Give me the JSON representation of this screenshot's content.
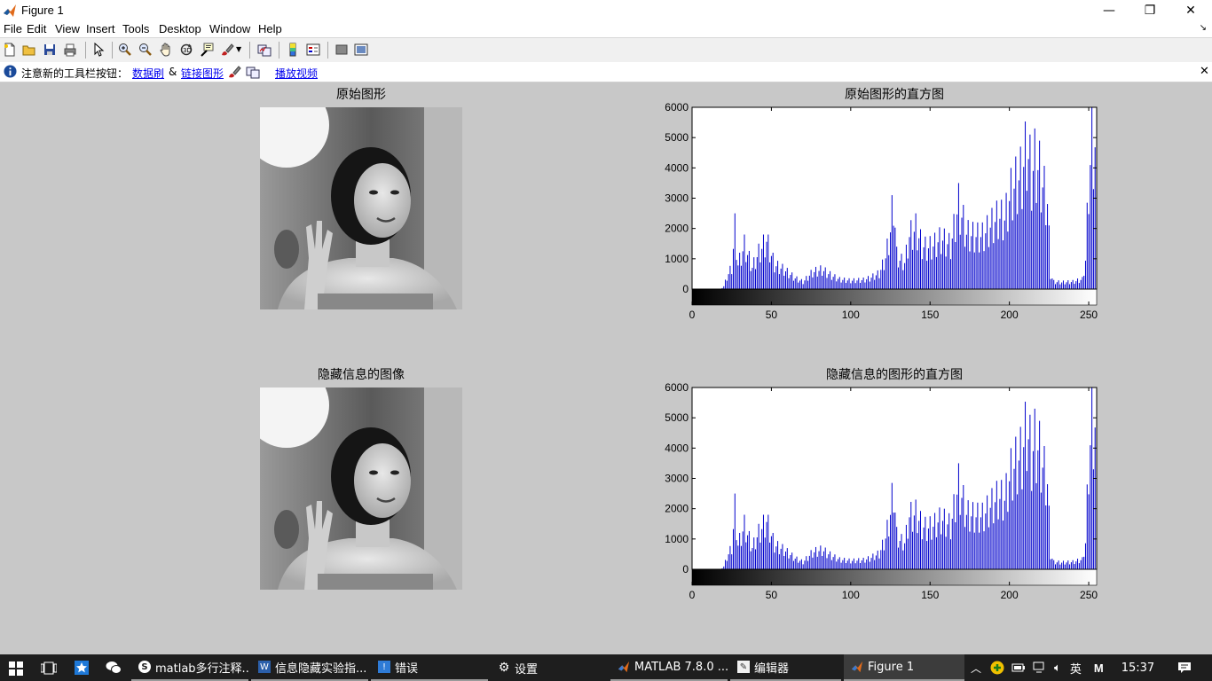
{
  "window": {
    "title": "Figure 1",
    "minimize": "—",
    "restore": "❐",
    "close": "✕"
  },
  "menu": [
    "File",
    "Edit",
    "View",
    "Insert",
    "Tools",
    "Desktop",
    "Window",
    "Help"
  ],
  "infobar": {
    "text": "注意新的工具栏按钮：",
    "link_brush": "数据刷",
    "amp": "&",
    "link_link": "链接图形",
    "link_play": "播放视频",
    "close": "✕"
  },
  "plots": {
    "top_left_title": "原始图形",
    "top_right_title": "原始图形的直方图",
    "bottom_left_title": "隐藏信息的图像",
    "bottom_right_title": "隐藏信息的图形的直方图"
  },
  "colors": {
    "bar": "#0000cc",
    "figure_bg": "#c8c8c8"
  },
  "chart_data": [
    {
      "type": "bar",
      "title": "原始图形的直方图",
      "xlim": [
        0,
        255
      ],
      "ylim": [
        0,
        6000
      ],
      "xticks": [
        "0",
        "50",
        "100",
        "150",
        "200",
        "250"
      ],
      "yticks": [
        "0",
        "1000",
        "2000",
        "3000",
        "4000",
        "5000",
        "6000"
      ],
      "colorbar": "gray",
      "anchors": [
        [
          0,
          0
        ],
        [
          18,
          0
        ],
        [
          20,
          120
        ],
        [
          22,
          500
        ],
        [
          25,
          900
        ],
        [
          27,
          2500
        ],
        [
          29,
          1000
        ],
        [
          33,
          1800
        ],
        [
          38,
          900
        ],
        [
          42,
          1500
        ],
        [
          47,
          2000
        ],
        [
          52,
          1000
        ],
        [
          58,
          800
        ],
        [
          65,
          450
        ],
        [
          70,
          300
        ],
        [
          76,
          700
        ],
        [
          82,
          800
        ],
        [
          88,
          550
        ],
        [
          93,
          400
        ],
        [
          100,
          350
        ],
        [
          108,
          380
        ],
        [
          112,
          450
        ],
        [
          118,
          650
        ],
        [
          122,
          1300
        ],
        [
          125,
          2400
        ],
        [
          127,
          3800
        ],
        [
          129,
          1400
        ],
        [
          131,
          1200
        ],
        [
          134,
          1100
        ],
        [
          137,
          2200
        ],
        [
          141,
          2500
        ],
        [
          145,
          1800
        ],
        [
          148,
          1700
        ],
        [
          152,
          1800
        ],
        [
          157,
          2100
        ],
        [
          163,
          1800
        ],
        [
          168,
          3500
        ],
        [
          173,
          2300
        ],
        [
          178,
          2200
        ],
        [
          183,
          2200
        ],
        [
          188,
          2600
        ],
        [
          193,
          3000
        ],
        [
          197,
          2900
        ],
        [
          201,
          4000
        ],
        [
          205,
          4500
        ],
        [
          208,
          4800
        ],
        [
          211,
          5900
        ],
        [
          214,
          4700
        ],
        [
          216,
          5300
        ],
        [
          219,
          4900
        ],
        [
          221,
          4300
        ],
        [
          224,
          3600
        ],
        [
          226,
          600
        ],
        [
          228,
          300
        ],
        [
          233,
          280
        ],
        [
          240,
          300
        ],
        [
          246,
          400
        ],
        [
          248,
          1200
        ],
        [
          250,
          4500
        ],
        [
          252,
          6000
        ],
        [
          255,
          6000
        ]
      ]
    },
    {
      "type": "bar",
      "title": "隐藏信息的图形的直方图",
      "xlim": [
        0,
        255
      ],
      "ylim": [
        0,
        6000
      ],
      "xticks": [
        "0",
        "50",
        "100",
        "150",
        "200",
        "250"
      ],
      "yticks": [
        "0",
        "1000",
        "2000",
        "3000",
        "4000",
        "5000",
        "6000"
      ],
      "colorbar": "gray",
      "anchors": [
        [
          0,
          0
        ],
        [
          18,
          0
        ],
        [
          20,
          120
        ],
        [
          22,
          500
        ],
        [
          25,
          900
        ],
        [
          27,
          2500
        ],
        [
          29,
          1000
        ],
        [
          33,
          1800
        ],
        [
          38,
          900
        ],
        [
          42,
          1500
        ],
        [
          47,
          2000
        ],
        [
          52,
          1000
        ],
        [
          58,
          800
        ],
        [
          65,
          450
        ],
        [
          70,
          300
        ],
        [
          76,
          700
        ],
        [
          82,
          800
        ],
        [
          88,
          550
        ],
        [
          93,
          400
        ],
        [
          100,
          350
        ],
        [
          108,
          380
        ],
        [
          112,
          450
        ],
        [
          118,
          650
        ],
        [
          122,
          1300
        ],
        [
          125,
          2300
        ],
        [
          127,
          3400
        ],
        [
          129,
          1400
        ],
        [
          131,
          1200
        ],
        [
          134,
          1100
        ],
        [
          137,
          2200
        ],
        [
          141,
          2300
        ],
        [
          145,
          1800
        ],
        [
          148,
          1700
        ],
        [
          152,
          1800
        ],
        [
          157,
          2100
        ],
        [
          163,
          1800
        ],
        [
          168,
          3500
        ],
        [
          173,
          2300
        ],
        [
          178,
          2200
        ],
        [
          183,
          2200
        ],
        [
          188,
          2600
        ],
        [
          193,
          3000
        ],
        [
          197,
          2900
        ],
        [
          201,
          4000
        ],
        [
          205,
          4500
        ],
        [
          208,
          4800
        ],
        [
          211,
          5900
        ],
        [
          214,
          4700
        ],
        [
          216,
          5300
        ],
        [
          219,
          4900
        ],
        [
          221,
          4300
        ],
        [
          224,
          3600
        ],
        [
          226,
          600
        ],
        [
          228,
          300
        ],
        [
          233,
          280
        ],
        [
          240,
          300
        ],
        [
          246,
          400
        ],
        [
          248,
          1100
        ],
        [
          250,
          4500
        ],
        [
          252,
          6000
        ],
        [
          255,
          6000
        ]
      ]
    }
  ],
  "taskbar": {
    "items": [
      {
        "label": "matlab多行注释...",
        "icon": "browser-icon"
      },
      {
        "label": "信息隐藏实验指...",
        "icon": "word-icon"
      },
      {
        "label": "错误",
        "icon": "error-app-icon"
      },
      {
        "label": "设置",
        "icon": "settings-icon"
      },
      {
        "label": "MATLAB  7.8.0 ...",
        "icon": "matlab-icon"
      },
      {
        "label": "编辑器",
        "icon": "editor-icon"
      },
      {
        "label": "Figure 1",
        "icon": "figure-icon"
      }
    ],
    "ime": "英",
    "ime2": "M",
    "time": "15:37"
  }
}
